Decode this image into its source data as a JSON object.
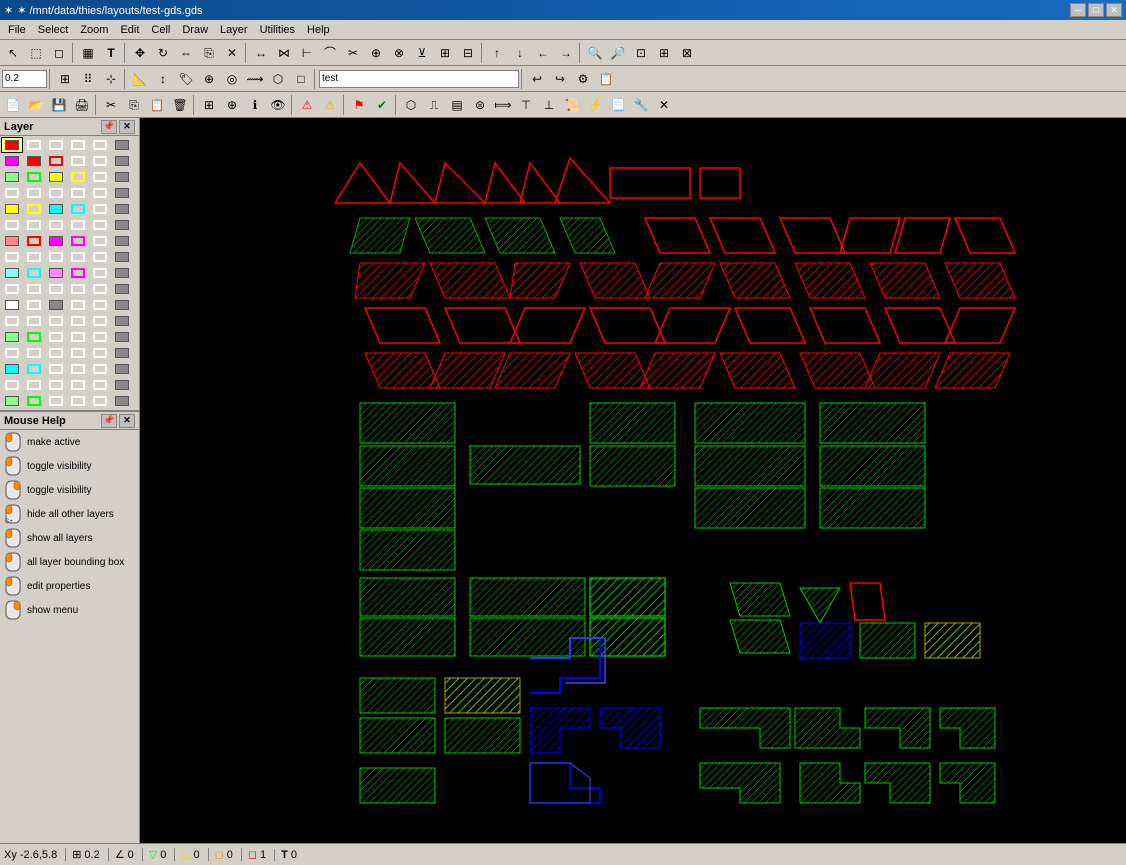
{
  "titlebar": {
    "title": "✶ /mnt/data/thies/layouts/test-gds.gds",
    "btn_min": "─",
    "btn_max": "□",
    "btn_close": "✕"
  },
  "menubar": {
    "items": [
      "File",
      "Select",
      "Zoom",
      "Edit",
      "Cell",
      "Draw",
      "Layer",
      "Utilities",
      "Help"
    ]
  },
  "toolbar1": {
    "coord_value": "0.2",
    "cell_name": "test"
  },
  "statusbar": {
    "coord": "Xy -2.6,5.8",
    "snap": "0.2",
    "angle": "0",
    "items": [
      "0",
      "0",
      "0",
      "1"
    ]
  },
  "layer_panel": {
    "title": "Layer",
    "rows": [
      [
        "red",
        "outline",
        "outline",
        "outline",
        "outline",
        "outline"
      ],
      [
        "magenta",
        "red",
        "outline-r",
        "outline",
        "outline",
        "gray"
      ],
      [
        "lt-green",
        "outline-g",
        "yellow",
        "outline-y",
        "outline",
        "gray"
      ],
      [
        "outline",
        "outline",
        "outline",
        "outline",
        "outline",
        "gray"
      ],
      [
        "yellow",
        "outline-y",
        "cyan",
        "outline-c",
        "outline",
        "gray"
      ],
      [
        "outline",
        "outline",
        "outline",
        "outline",
        "outline",
        "gray"
      ],
      [
        "lt-red",
        "outline-r",
        "magenta",
        "outline-m",
        "outline",
        "gray"
      ],
      [
        "outline",
        "outline",
        "outline",
        "outline",
        "outline",
        "gray"
      ],
      [
        "lt-cyan",
        "outline-c",
        "lt-mag",
        "outline-m",
        "outline",
        "gray"
      ],
      [
        "outline",
        "outline",
        "outline",
        "outline",
        "outline",
        "gray"
      ],
      [
        "white",
        "outline",
        "gray",
        "outline",
        "outline",
        "gray"
      ],
      [
        "outline",
        "outline",
        "outline",
        "outline",
        "outline",
        "gray"
      ],
      [
        "lt-green",
        "outline-g",
        "outline",
        "outline",
        "outline",
        "gray"
      ],
      [
        "outline",
        "outline",
        "outline",
        "outline",
        "outline",
        "gray"
      ],
      [
        "cyan",
        "outline-c",
        "outline",
        "outline",
        "outline",
        "gray"
      ],
      [
        "outline",
        "outline",
        "outline",
        "outline",
        "outline",
        "gray"
      ],
      [
        "lt-green",
        "outline-g",
        "outline",
        "outline",
        "outline",
        "gray"
      ]
    ]
  },
  "mouse_panel": {
    "title": "Mouse Help",
    "actions": [
      {
        "icon": "left",
        "label": "make active"
      },
      {
        "icon": "left",
        "label": "toggle visibility"
      },
      {
        "icon": "right",
        "label": "toggle visibility"
      },
      {
        "icon": "left",
        "label": "hide all other layers"
      },
      {
        "icon": "left",
        "label": "show all layers"
      },
      {
        "icon": "left",
        "label": "all layer bounding box"
      },
      {
        "icon": "left",
        "label": "edit properties"
      },
      {
        "icon": "left",
        "label": "show menu"
      }
    ]
  }
}
